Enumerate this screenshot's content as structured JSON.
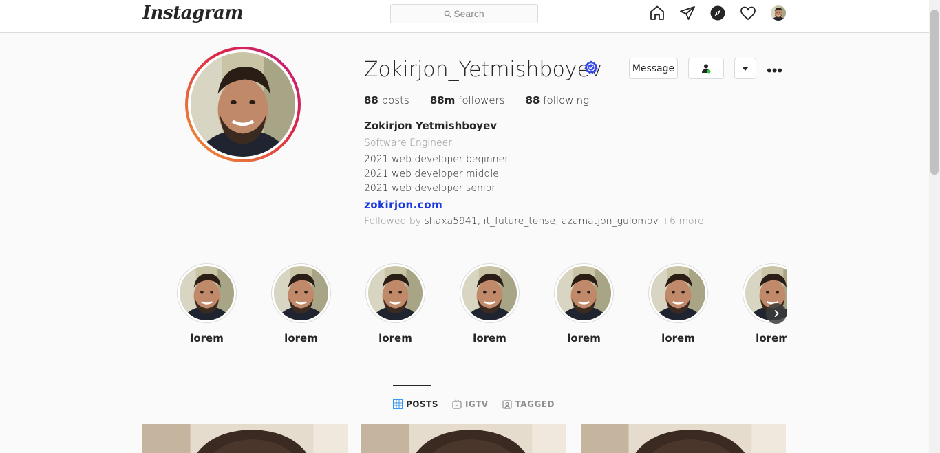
{
  "header": {
    "logo": "Instagram",
    "search_placeholder": "Search"
  },
  "profile": {
    "username": "Zokirjon_Yetmishboyev",
    "message_label": "Message",
    "more_label": "•••",
    "stats": {
      "posts_count": "88",
      "posts_label": "posts",
      "followers_count": "88m",
      "followers_label": "followers",
      "following_count": "88",
      "following_label": "following"
    },
    "full_name": "Zokirjon Yetmishboyev",
    "category": "Software Engineer",
    "bio_lines": [
      "2021 web developer beginner",
      "2021 web developer middle",
      "2021 web developer senior"
    ],
    "website": "zokirjon.com",
    "followed_by_prefix": "Followed by",
    "followed_by_names": "shaxa5941, it_future_tense, azamatjon_gulomov",
    "followed_by_more": "+6 more"
  },
  "highlights": [
    {
      "label": "lorem"
    },
    {
      "label": "lorem"
    },
    {
      "label": "lorem"
    },
    {
      "label": "lorem"
    },
    {
      "label": "lorem"
    },
    {
      "label": "lorem"
    },
    {
      "label": "lorem"
    }
  ],
  "tabs": [
    {
      "label": "POSTS",
      "icon": "grid-icon",
      "active": true
    },
    {
      "label": "IGTV",
      "icon": "igtv-icon",
      "active": false
    },
    {
      "label": "TAGGED",
      "icon": "tagged-icon",
      "active": false
    }
  ],
  "colors": {
    "verified": "#3848e8",
    "link": "#1a39e0",
    "ring_gradient_start": "#f09433",
    "ring_gradient_end": "#bc1888"
  }
}
